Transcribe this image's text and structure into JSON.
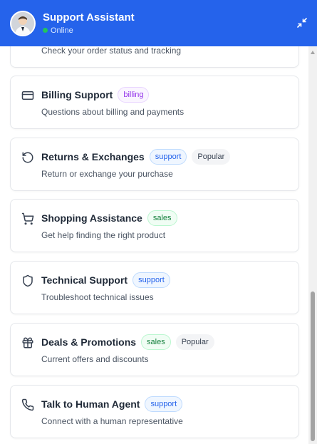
{
  "header": {
    "title": "Support Assistant",
    "status": "Online",
    "status_color": "#22c55e",
    "brand_color": "#2563eb",
    "avatar_icon": "agent-avatar",
    "minimize_icon": "collapse-arrows-icon"
  },
  "options": [
    {
      "title": "",
      "desc": "Check your order status and tracking",
      "icon": "package-icon",
      "badges": []
    },
    {
      "title": "Billing Support",
      "desc": "Questions about billing and payments",
      "icon": "credit-card-icon",
      "badges": [
        {
          "label": "billing",
          "kind": "billing"
        }
      ]
    },
    {
      "title": "Returns & Exchanges",
      "desc": "Return or exchange your purchase",
      "icon": "rotate-ccw-icon",
      "badges": [
        {
          "label": "support",
          "kind": "support"
        },
        {
          "label": "Popular",
          "kind": "popular"
        }
      ]
    },
    {
      "title": "Shopping Assistance",
      "desc": "Get help finding the right product",
      "icon": "shopping-cart-icon",
      "badges": [
        {
          "label": "sales",
          "kind": "sales"
        }
      ]
    },
    {
      "title": "Technical Support",
      "desc": "Troubleshoot technical issues",
      "icon": "shield-icon",
      "badges": [
        {
          "label": "support",
          "kind": "support"
        }
      ]
    },
    {
      "title": "Deals & Promotions",
      "desc": "Current offers and discounts",
      "icon": "gift-icon",
      "badges": [
        {
          "label": "sales",
          "kind": "sales"
        },
        {
          "label": "Popular",
          "kind": "popular"
        }
      ]
    },
    {
      "title": "Talk to Human Agent",
      "desc": "Connect with a human representative",
      "icon": "phone-icon",
      "badges": [
        {
          "label": "support",
          "kind": "support"
        }
      ]
    }
  ]
}
